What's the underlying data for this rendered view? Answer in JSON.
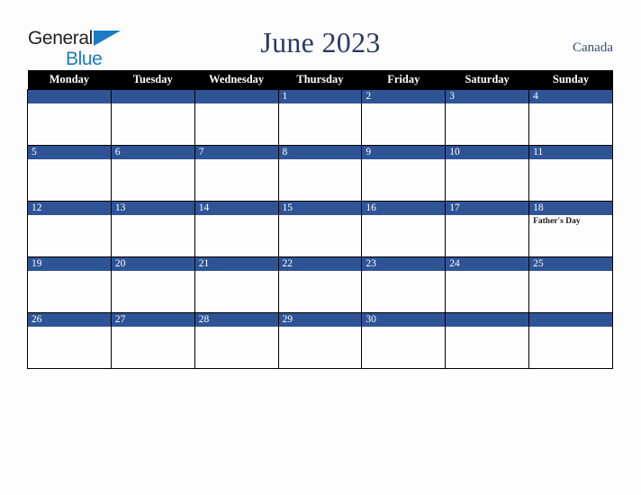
{
  "header": {
    "logo": {
      "word1": "General",
      "word2": "Blue",
      "triangle_color": "#1b7cc4",
      "word1_color": "#231f20",
      "word2_color": "#1b7cc4"
    },
    "title": "June 2023",
    "country": "Canada"
  },
  "theme": {
    "page_background": "#fdfdfd",
    "dow_header_background": "#000000",
    "dow_header_text": "#ffffff",
    "daynum_bar_background": "#2f5496",
    "daynum_text": "#ffffff",
    "cell_border": "#000000",
    "cell_background": "#fdfdfd",
    "title_color": "#2b3a62",
    "country_color": "#3a4a73",
    "event_text": "#1a1a1a"
  },
  "calendar": {
    "month": "June",
    "year": "2023",
    "weekday_headers": [
      "Monday",
      "Tuesday",
      "Wednesday",
      "Thursday",
      "Friday",
      "Saturday",
      "Sunday"
    ],
    "weeks": [
      [
        {
          "day": "",
          "shaded": true,
          "event": ""
        },
        {
          "day": "",
          "shaded": true,
          "event": ""
        },
        {
          "day": "",
          "shaded": true,
          "event": ""
        },
        {
          "day": "1",
          "shaded": true,
          "event": ""
        },
        {
          "day": "2",
          "shaded": true,
          "event": ""
        },
        {
          "day": "3",
          "shaded": true,
          "event": ""
        },
        {
          "day": "4",
          "shaded": true,
          "event": ""
        }
      ],
      [
        {
          "day": "5",
          "shaded": true,
          "event": ""
        },
        {
          "day": "6",
          "shaded": true,
          "event": ""
        },
        {
          "day": "7",
          "shaded": true,
          "event": ""
        },
        {
          "day": "8",
          "shaded": true,
          "event": ""
        },
        {
          "day": "9",
          "shaded": true,
          "event": ""
        },
        {
          "day": "10",
          "shaded": true,
          "event": ""
        },
        {
          "day": "11",
          "shaded": true,
          "event": ""
        }
      ],
      [
        {
          "day": "12",
          "shaded": true,
          "event": ""
        },
        {
          "day": "13",
          "shaded": true,
          "event": ""
        },
        {
          "day": "14",
          "shaded": true,
          "event": ""
        },
        {
          "day": "15",
          "shaded": true,
          "event": ""
        },
        {
          "day": "16",
          "shaded": true,
          "event": ""
        },
        {
          "day": "17",
          "shaded": true,
          "event": ""
        },
        {
          "day": "18",
          "shaded": true,
          "event": "Father's Day"
        }
      ],
      [
        {
          "day": "19",
          "shaded": true,
          "event": ""
        },
        {
          "day": "20",
          "shaded": true,
          "event": ""
        },
        {
          "day": "21",
          "shaded": true,
          "event": ""
        },
        {
          "day": "22",
          "shaded": true,
          "event": ""
        },
        {
          "day": "23",
          "shaded": true,
          "event": ""
        },
        {
          "day": "24",
          "shaded": true,
          "event": ""
        },
        {
          "day": "25",
          "shaded": true,
          "event": ""
        }
      ],
      [
        {
          "day": "26",
          "shaded": true,
          "event": ""
        },
        {
          "day": "27",
          "shaded": true,
          "event": ""
        },
        {
          "day": "28",
          "shaded": true,
          "event": ""
        },
        {
          "day": "29",
          "shaded": true,
          "event": ""
        },
        {
          "day": "30",
          "shaded": true,
          "event": ""
        },
        {
          "day": "",
          "shaded": true,
          "event": ""
        },
        {
          "day": "",
          "shaded": true,
          "event": ""
        }
      ]
    ]
  }
}
